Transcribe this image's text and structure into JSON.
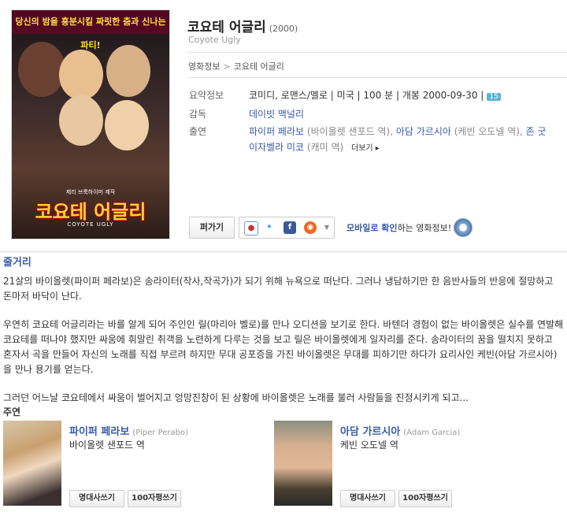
{
  "poster": {
    "banner": "당신의 밤을 흥분시킬 짜릿한 춤과 신나는 파티!",
    "title": "코요테 어글리",
    "subtitle": "COYOTE UGLY",
    "small": "제리 브룩하이머 제작"
  },
  "movie": {
    "title_ko": "코요테 어글리",
    "year": "(2000)",
    "title_en": "Coyote Ugly"
  },
  "breadcrumb": {
    "parent": "영화정보",
    "separator": ">",
    "current": "코요테 어글리"
  },
  "info": {
    "summary_label": "요약정보",
    "summary_value": "코미디, 로맨스/멜로 | 미국 | 100 분 | 개봉 2000-09-30 |",
    "rating_badge": "15",
    "director_label": "감독",
    "director_value": "데이빗 맥널리",
    "cast_label": "출연",
    "cast_1_name": "파이퍼 페라보",
    "cast_1_role": "(바이올렛 샌포드 역),",
    "cast_2_name": "아담 가르시아",
    "cast_2_role": "(케빈 오도넬 역),",
    "cast_3_name": "존 굿",
    "cast_4_name": "이자벨라 미코",
    "cast_4_role": "(캐미 역)",
    "more": "더보기 ▸"
  },
  "actions": {
    "scrap": "퍼가기",
    "mobile_link": "모바일로 확인",
    "mobile_text": "하는 영화정보!",
    "share_icons": [
      "me2day-icon",
      "twitter-icon",
      "facebook-icon",
      "yozm-icon"
    ]
  },
  "plot": {
    "heading": "줄거리",
    "p1": "21살의 바이올렛(파이퍼 페라보)은 송라이터(작사,작곡가)가 되기 위해 뉴욕으로 떠난다. 그러나 냉담하기만 한 음반사들의 반응에 절망하고 돈마저 바닥이 난다.",
    "p2": "우연히 코요테 어글리라는 바를 알게 되어 주인인 릴(마리아 벨로)를 만나 오디션을 보기로 한다. 바텐더 경험이 없는 바이올렛은 실수를 연발해 코요테를 떠나야 했지만 싸움에 휘말린 취객을 노련하게 다루는 것을 보고 릴은 바이올렛에게 일자리를 준다. 송라이터의 꿈을 떨치지 못하고 혼자서 곡을 만들어 자신의 노래를 직접 부르려 하지만 무대 공포증을 가진 바이올렛은 무대를 피하기만 하다가 요리사인 케빈(아담 가르시아)을 만나 용기를 얻는다.",
    "p3": "그러던 어느날 코요테에서 싸움이 벌어지고 엉망진창이 된 상황에 바이올렛은 노래를 불러 사람들을 진정시키게 되고..."
  },
  "cast": {
    "heading": "주연",
    "actors": [
      {
        "name": "파이퍼 페라보",
        "name_en": "(Piper Perabo)",
        "role": "바이올렛 샌포드 역",
        "btn1": "명대사쓰기",
        "btn2": "100자평쓰기"
      },
      {
        "name": "아담 가르시아",
        "name_en": "(Adam Garcia)",
        "role": "케빈 오도넬 역",
        "btn1": "명대사쓰기",
        "btn2": "100자평쓰기"
      }
    ]
  },
  "colors": {
    "link": "#3b5aa8",
    "badge": "#5bb5d5",
    "poster_title": "#ffd23a"
  }
}
